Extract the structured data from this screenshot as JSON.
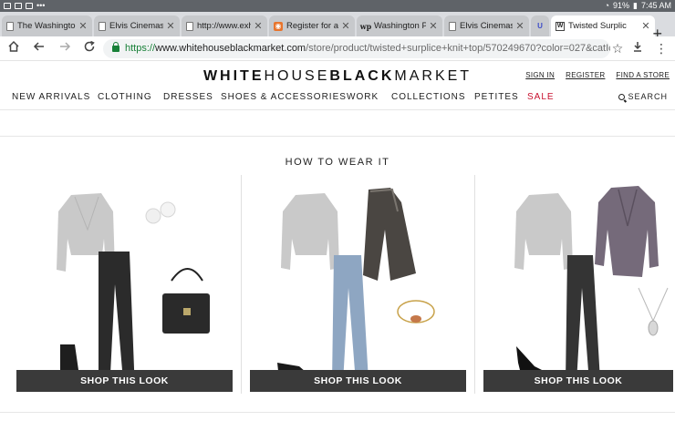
{
  "status_bar": {
    "battery": "91%",
    "time": "7:45 AM"
  },
  "tabs": [
    {
      "title": "The Washingto",
      "favicon": "page-icon"
    },
    {
      "title": "Elvis Cinemas",
      "favicon": "page-icon"
    },
    {
      "title": "http://www.exh",
      "favicon": "page-icon"
    },
    {
      "title": "Register for a F",
      "favicon": "register-icon"
    },
    {
      "title": "Washington Po",
      "favicon": "washington-post-icon"
    },
    {
      "title": "Elvis Cinemas",
      "favicon": "page-icon"
    },
    {
      "title": "",
      "favicon": "u-icon"
    },
    {
      "title": "Twisted Surplic",
      "favicon": "whbm-icon",
      "active": true
    }
  ],
  "address_bar": {
    "scheme": "https://",
    "host": "www.whitehouseblackmarket.com",
    "path": "/store/product/twisted+surplice+knit+top/570249670?color=027&catId=ca"
  },
  "header": {
    "brand_part1": "WHITE",
    "brand_part2": "HOUSE",
    "brand_part3": "BLACK",
    "brand_part4": "MARKET",
    "sign_in": "SIGN IN",
    "register": "REGISTER",
    "find_store": "FIND A STORE"
  },
  "nav": {
    "items": [
      "NEW ARRIVALS",
      "CLOTHING",
      "DRESSES",
      "SHOES & ACCESSORIES",
      "WORK",
      "COLLECTIONS",
      "PETITES",
      "SALE"
    ],
    "search": "SEARCH"
  },
  "section": {
    "title": "HOW TO WEAR IT"
  },
  "looks": [
    {
      "button": "SHOP THIS LOOK"
    },
    {
      "button": "SHOP THIS LOOK"
    },
    {
      "button": "SHOP THIS LOOK"
    }
  ],
  "colors": {
    "sale": "#c8102e",
    "button_bg": "#3a3a3a",
    "secure_green": "#188038"
  }
}
